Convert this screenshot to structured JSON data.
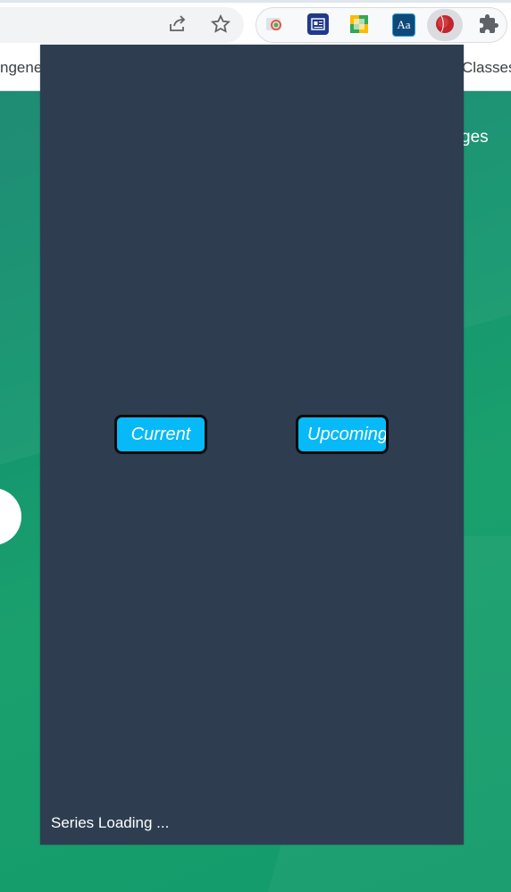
{
  "toolbar": {
    "share_icon": "share-icon",
    "bookmark_icon": "star-icon",
    "extensions": [
      {
        "name": "photos-extension-icon"
      },
      {
        "name": "news-extension-icon"
      },
      {
        "name": "sheets-extension-icon"
      },
      {
        "name": "dictionary-extension-icon",
        "label": "Aa"
      },
      {
        "name": "cricket-ball-extension-icon"
      },
      {
        "name": "puzzle-extensions-icon"
      }
    ]
  },
  "bookmarks": {
    "left_partial": "ngene",
    "right_partial": "Classes"
  },
  "background": {
    "partial_text": "ges"
  },
  "popup": {
    "tabs": {
      "current": "Current",
      "upcoming": "Upcoming"
    },
    "status": "Series Loading ...",
    "colors": {
      "background": "#2e3e50",
      "button": "#07b9f7"
    }
  }
}
